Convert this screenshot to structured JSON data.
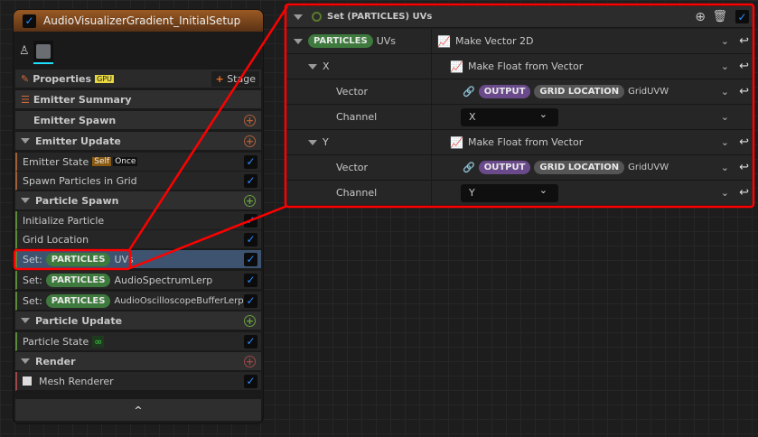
{
  "emitter": {
    "title": "AudioVisualizerGradient_InitialSetup",
    "properties": "Properties",
    "gpu_badge": "GPU",
    "stage_button": "Stage",
    "summary": "Emitter Summary",
    "sections": {
      "emitter_spawn": "Emitter Spawn",
      "emitter_update": "Emitter Update",
      "particle_spawn": "Particle Spawn",
      "particle_update": "Particle Update",
      "render": "Render"
    },
    "items": {
      "emitter_state": "Emitter State",
      "self_badge": "Self",
      "once_badge": "Once",
      "spawn_grid": "Spawn Particles in Grid",
      "init_particle": "Initialize Particle",
      "grid_location": "Grid Location",
      "set_prefix": "Set:",
      "particles": "PARTICLES",
      "uvs": "UVs",
      "spectrum": "AudioSpectrumLerp",
      "osc": "AudioOscilloscopeBufferLerp",
      "particle_state": "Particle State",
      "infinity": "∞",
      "mesh_renderer": "Mesh Renderer"
    },
    "collapse": "^"
  },
  "module": {
    "title": "Set (PARTICLES) UVs",
    "ns": "PARTICLES",
    "param": "UVs",
    "make_vec": "Make Vector 2D",
    "x": "X",
    "y": "Y",
    "make_float": "Make Float from Vector",
    "vector": "Vector",
    "channel": "Channel",
    "output": "OUTPUT",
    "grid_loc": "GRID LOCATION",
    "griduvw": "GridUVW",
    "chan_x": "X",
    "chan_y": "Y"
  },
  "colors": {
    "highlight": "#ff0000",
    "check": "#2d8cff"
  }
}
